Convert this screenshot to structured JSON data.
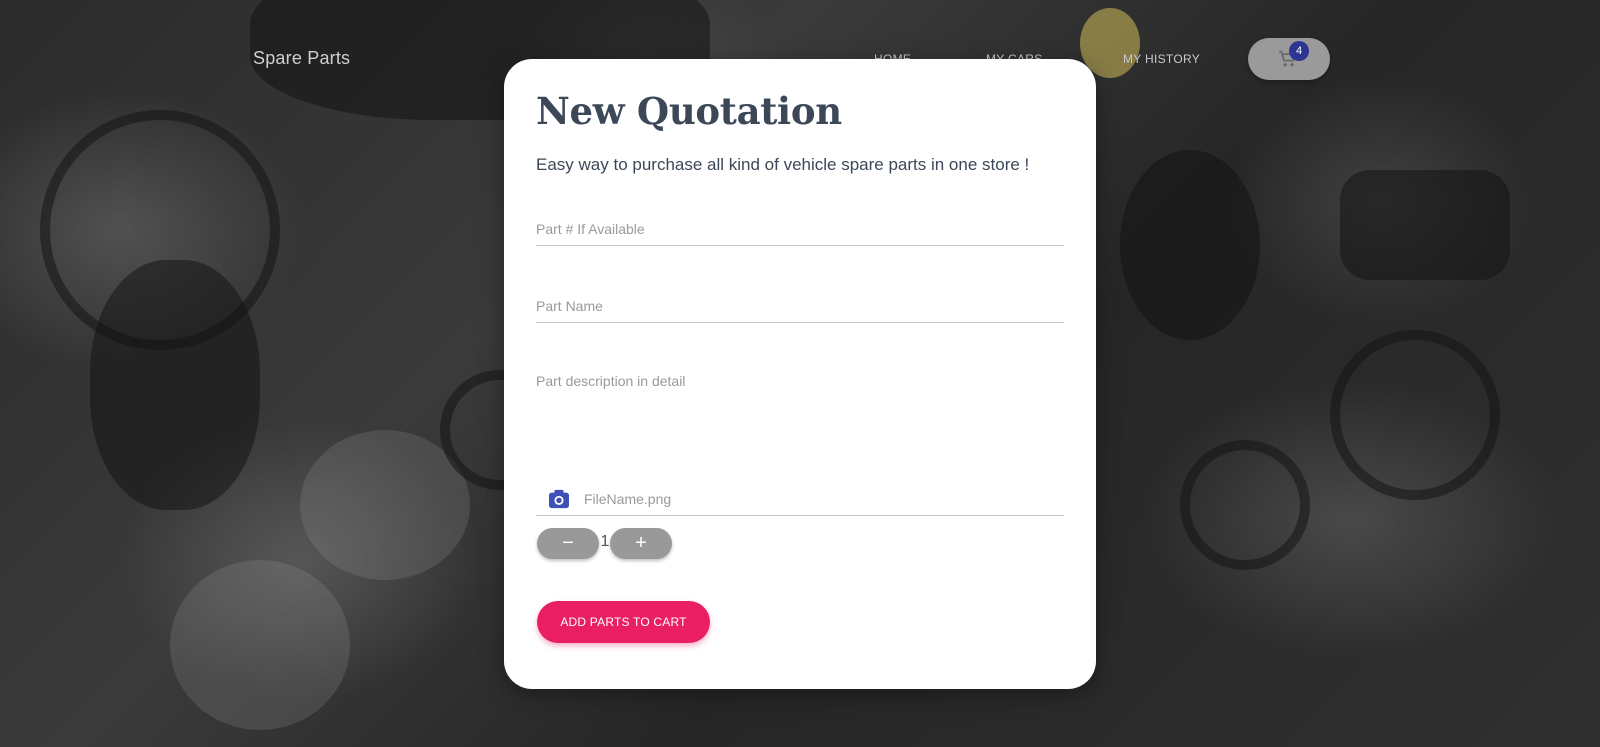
{
  "nav": {
    "brand": "Spare Parts",
    "links": [
      {
        "label": "HOME"
      },
      {
        "label": "MY CARS"
      },
      {
        "label": "MY HISTORY"
      }
    ],
    "cart": {
      "count": "4",
      "icon": "cart-icon",
      "button_color": "#9a9a9a",
      "badge_color": "#2c3592"
    }
  },
  "card": {
    "title": "New Quotation",
    "subtitle": "Easy way to purchase all kind of vehicle spare parts in one store !",
    "fields": {
      "part_number": {
        "value": "",
        "placeholder": "Part # If Available"
      },
      "part_name": {
        "value": "",
        "placeholder": "Part Name"
      },
      "description": {
        "value": "",
        "placeholder": "Part description in detail"
      }
    },
    "file": {
      "icon": "camera-icon",
      "name": "FileName.png",
      "icon_color": "#3f51b5"
    },
    "quantity": {
      "minus_label": "−",
      "value": "1",
      "plus_label": "+"
    },
    "submit": {
      "label": "ADD PARTS TO CART",
      "color": "#e91e63"
    }
  }
}
